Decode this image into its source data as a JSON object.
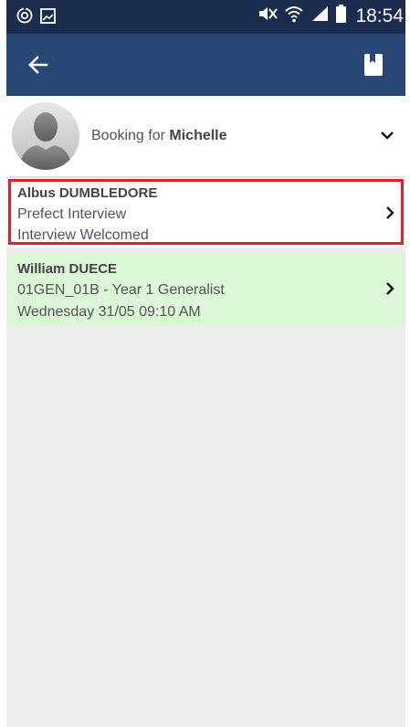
{
  "status_bar": {
    "time": "18:54",
    "icons": [
      "sync-icon",
      "image-icon",
      "mute-icon",
      "wifi-icon",
      "signal-icon",
      "battery-icon"
    ]
  },
  "app_bar": {
    "back_icon": "arrow-left-icon",
    "action_icon": "bookmark-icon"
  },
  "booking": {
    "prefix": "Booking for",
    "name": "Michelle"
  },
  "appointments": [
    {
      "name": "Albus DUMBLEDORE",
      "line2": "Prefect Interview",
      "line3": "Interview Welcomed",
      "highlighted": true
    },
    {
      "name": "William DUECE",
      "line2": "01GEN_01B - Year 1 Generalist",
      "line3": "Wednesday 31/05 09:10 AM",
      "highlighted": false
    }
  ],
  "colors": {
    "status_bar": "#1b2d4f",
    "app_bar": "#284775",
    "background": "#ededed",
    "highlight_border": "#e51d26",
    "confirmed_row": "#dcf6d8"
  }
}
